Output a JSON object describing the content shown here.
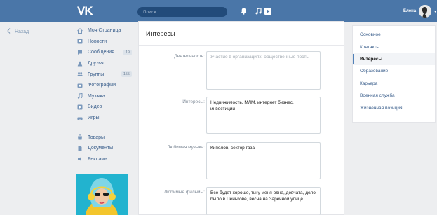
{
  "header": {
    "logo": "VK",
    "search_placeholder": "Поиск",
    "user_name": "Елена"
  },
  "back_label": "Назад",
  "left_nav": {
    "items": [
      {
        "label": "Моя Страница",
        "icon": "home-icon",
        "count": ""
      },
      {
        "label": "Новости",
        "icon": "news-icon",
        "count": ""
      },
      {
        "label": "Сообщения",
        "icon": "messages-icon",
        "count": "19"
      },
      {
        "label": "Друзья",
        "icon": "friends-icon",
        "count": ""
      },
      {
        "label": "Группы",
        "icon": "groups-icon",
        "count": "155"
      },
      {
        "label": "Фотографии",
        "icon": "photos-icon",
        "count": ""
      },
      {
        "label": "Музыка",
        "icon": "music-icon",
        "count": ""
      },
      {
        "label": "Видео",
        "icon": "video-icon",
        "count": ""
      },
      {
        "label": "Игры",
        "icon": "games-icon",
        "count": ""
      }
    ],
    "items2": [
      {
        "label": "Товары",
        "icon": "goods-icon"
      },
      {
        "label": "Документы",
        "icon": "documents-icon"
      },
      {
        "label": "Реклама",
        "icon": "ads-icon"
      }
    ]
  },
  "main": {
    "title": "Интересы",
    "fields": [
      {
        "label": "Деятельность:",
        "value": "",
        "placeholder": "Участие в организациях, общественные посты"
      },
      {
        "label": "Интересы:",
        "value": "Недвижимость, МЛМ, интернет бизнес, инвестиции",
        "placeholder": ""
      },
      {
        "label": "Любимая музыка:",
        "value": "Кипелов, сектор газа",
        "placeholder": ""
      },
      {
        "label": "Любимые фильмы:",
        "value": "Все будет хорошо, ты у меня одна, девчата, дело было в Пенькове, весна на Заречной улице",
        "placeholder": ""
      }
    ]
  },
  "right_menu": {
    "items": [
      {
        "label": "Основное",
        "active": false
      },
      {
        "label": "Контакты",
        "active": false
      },
      {
        "label": "Интересы",
        "active": true
      },
      {
        "label": "Образование",
        "active": false
      },
      {
        "label": "Карьера",
        "active": false
      },
      {
        "label": "Военная служба",
        "active": false
      },
      {
        "label": "Жизненная позиция",
        "active": false
      }
    ]
  },
  "colors": {
    "header": "#4a76a8",
    "link": "#3b5f8c",
    "accent": "#5181b8"
  }
}
